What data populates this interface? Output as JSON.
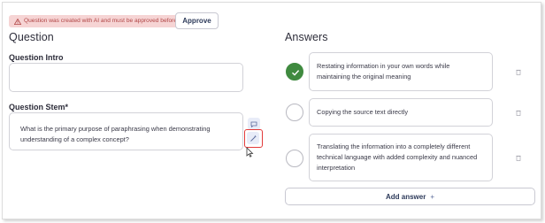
{
  "banner": {
    "text": "Question was created with AI and must be approved before publishing",
    "icon": "warning-icon"
  },
  "approve_label": "Approve",
  "question": {
    "heading": "Question",
    "intro_label": "Question Intro",
    "intro_value": "",
    "stem_label": "Question Stem*",
    "stem_value": "What is the primary purpose of paraphrasing when demonstrating understanding of a complex concept?"
  },
  "answers": {
    "heading": "Answers",
    "items": [
      {
        "text": "Restating information in your own words while maintaining the original meaning",
        "correct": true
      },
      {
        "text": "Copying the source text directly",
        "correct": false
      },
      {
        "text": "Translating the information into a completely different technical language with added complexity and nuanced interpretation",
        "correct": false
      }
    ],
    "add_label": "Add answer",
    "add_icon": "+"
  },
  "colors": {
    "correct": "#3f8a3f",
    "banner_bg": "#f6d4d4",
    "banner_text": "#b04545",
    "highlight": "#e23a3a"
  }
}
